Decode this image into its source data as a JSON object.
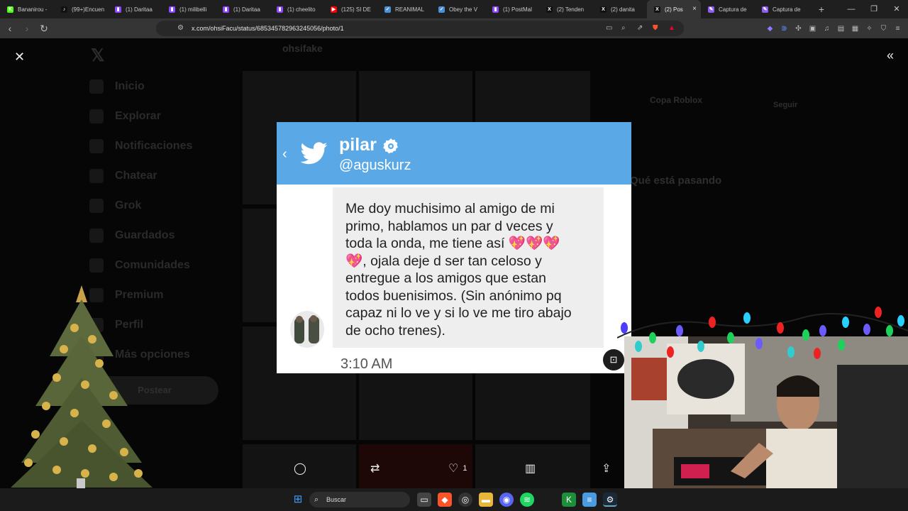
{
  "browser": {
    "tabs": [
      {
        "title": "Bananirou -",
        "color": "#53fc18",
        "glyph": "K"
      },
      {
        "title": "(99+)Encuen",
        "color": "#111111",
        "glyph": "♪"
      },
      {
        "title": "(1) Daritaa",
        "color": "#9146ff",
        "glyph": "▮"
      },
      {
        "title": "(1) milibelli",
        "color": "#9146ff",
        "glyph": "▮"
      },
      {
        "title": "(1) Daritaa",
        "color": "#9146ff",
        "glyph": "▮"
      },
      {
        "title": "(1) cheelito",
        "color": "#9146ff",
        "glyph": "▮"
      },
      {
        "title": "(125) SI DE",
        "color": "#ff0000",
        "glyph": "▶"
      },
      {
        "title": "REANIMAL",
        "color": "#4a90d9",
        "glyph": "✓"
      },
      {
        "title": "Obey the V",
        "color": "#4a90d9",
        "glyph": "✓"
      },
      {
        "title": "(1) PostMal",
        "color": "#9146ff",
        "glyph": "▮"
      },
      {
        "title": "(2) Tenden",
        "color": "#111111",
        "glyph": "X"
      },
      {
        "title": "(2) danita",
        "color": "#111111",
        "glyph": "X"
      },
      {
        "title": "(2) Pos",
        "color": "#111111",
        "glyph": "X",
        "active": true
      },
      {
        "title": "Captura de",
        "color": "#8b5cf6",
        "glyph": "✎"
      },
      {
        "title": "Captura de",
        "color": "#8b5cf6",
        "glyph": "✎"
      }
    ],
    "url": "x.com/ohsiFacu/status/685345782963245056/photo/1"
  },
  "background_page": {
    "profile_name": "ohsifake",
    "nav": [
      "Inicio",
      "Explorar",
      "Notificaciones",
      "Chatear",
      "Grok",
      "Guardados",
      "Comunidades",
      "Premium",
      "Perfil",
      "Más opciones"
    ],
    "post_button": "Postear",
    "trending_title": "Qué está pasando",
    "suggest_name": "Copa Roblox",
    "suggest_button": "Seguir"
  },
  "card": {
    "name": "pilar",
    "handle": "@aguskurz",
    "message_lines": [
      "Me doy muchisimo al amigo de mi",
      "primo, hablamos un par d veces y",
      "toda la onda, me tiene así 💖💖💖",
      "💖, ojala deje d ser tan celoso y",
      "entregue a los amigos que estan",
      "todos buenisimos. (Sin anónimo pq",
      "capaz ni lo ve y si lo ve me tiro abajo",
      "de ocho trenes)."
    ],
    "time": "3:10 AM"
  },
  "actions": {
    "likes": "1"
  },
  "taskbar": {
    "search_placeholder": "Buscar"
  },
  "colors": {
    "twitter_blue": "#5aa9e6",
    "bubble_gray": "#eeeeee",
    "heart_pink": "#e84a8a"
  }
}
